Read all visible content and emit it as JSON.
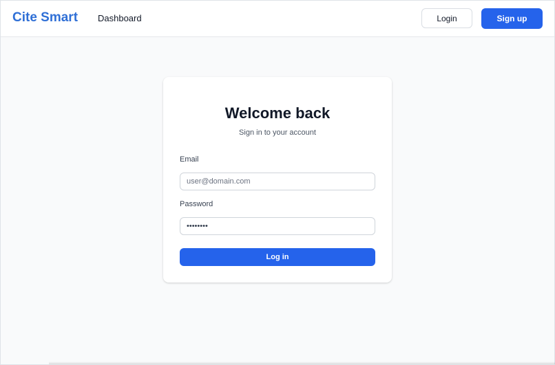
{
  "header": {
    "brand": "Cite Smart",
    "nav_dashboard": "Dashboard",
    "login_label": "Login",
    "signup_label": "Sign up"
  },
  "login_card": {
    "title": "Welcome back",
    "subtitle": "Sign in to your account",
    "email_label": "Email",
    "email_placeholder": "user@domain.com",
    "email_value": "",
    "password_label": "Password",
    "password_value": "••••••••",
    "submit_label": "Log in"
  },
  "colors": {
    "brand": "#2f6fd6",
    "primary": "#2563eb",
    "background": "#f9fafb"
  }
}
